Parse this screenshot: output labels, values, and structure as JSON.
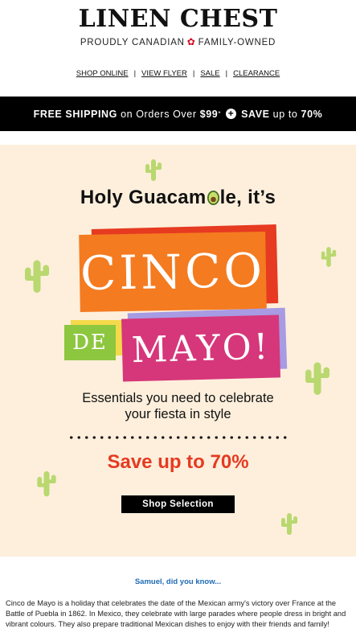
{
  "header": {
    "logo": "LINEN CHEST",
    "tagline_left": "PROUDLY CANADIAN",
    "tagline_right": "FAMILY-OWNED",
    "maple_leaf_icon": "maple-leaf-icon"
  },
  "nav": {
    "items": [
      {
        "label": "SHOP ONLINE"
      },
      {
        "label": "VIEW FLYER"
      },
      {
        "label": "SALE"
      },
      {
        "label": "CLEARANCE"
      }
    ],
    "separator": "|"
  },
  "promo_bar": {
    "free_shipping": "FREE SHIPPING",
    "on_orders": "on Orders Over",
    "amount": "$99",
    "asterisk": "*",
    "save": "SAVE",
    "up_to": "up to",
    "percent": "70%"
  },
  "hero": {
    "headline_part1": "Holy Guacam",
    "headline_part2": "le, it’s",
    "cinco": "CINCO",
    "de": "DE",
    "mayo": "MAYO!",
    "subtitle_line1": "Essentials you need to celebrate",
    "subtitle_line2": "your fiesta in style",
    "save_text": "Save up to 70%",
    "button_label": "Shop Selection",
    "colors": {
      "background": "#fdefdc",
      "cinco_orange": "#f47b20",
      "cinco_red": "#e63a21",
      "de_green": "#8dc63f",
      "de_yellow": "#f4d94a",
      "mayo_pink": "#d6377a",
      "mayo_lavender": "#a79be3",
      "cactus_green": "#b9d86f",
      "save_red": "#e63a21"
    }
  },
  "content": {
    "did_you_know": "Samuel, did you know...",
    "paragraph": "Cinco de Mayo is a holiday that celebrates the date of the Mexican army's victory over France at the Battle of Puebla in 1862. In Mexico, they celebrate with large parades where people dress in bright and vibrant colours. They also prepare traditional Mexican dishes to enjoy with their friends and family!"
  }
}
